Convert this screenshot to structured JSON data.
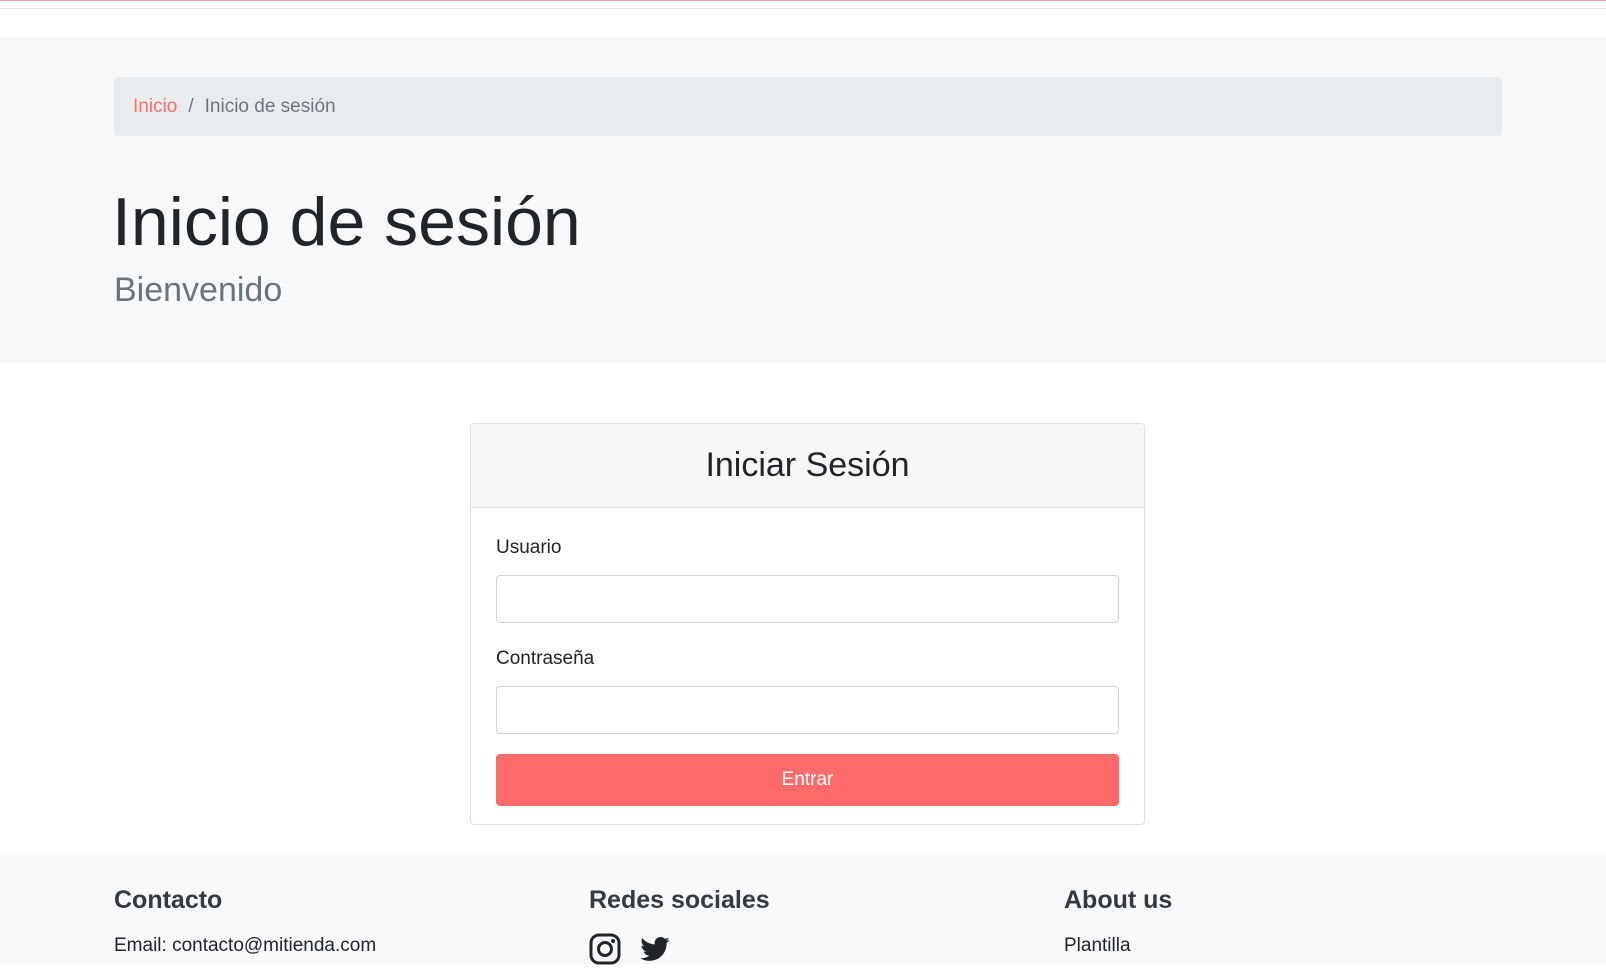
{
  "breadcrumb": {
    "home": "Inicio",
    "separator": "/",
    "current": "Inicio de sesión"
  },
  "header": {
    "title": "Inicio de sesión",
    "subtitle": "Bienvenido"
  },
  "login_card": {
    "title": "Iniciar Sesión",
    "username_label": "Usuario",
    "username_value": "",
    "password_label": "Contraseña",
    "password_value": "",
    "submit_label": "Entrar"
  },
  "footer": {
    "contact_title": "Contacto",
    "contact_email": "Email: contacto@mitienda.com",
    "social_title": "Redes sociales",
    "social_icons": [
      "instagram-icon",
      "twitter-icon"
    ],
    "about_title": "About us",
    "about_text": "Plantilla"
  },
  "colors": {
    "accent": "#ff6b6b",
    "hero_bg": "#f8f9fa",
    "breadcrumb_bg": "#e9ecef",
    "text_muted": "#6c757d"
  }
}
